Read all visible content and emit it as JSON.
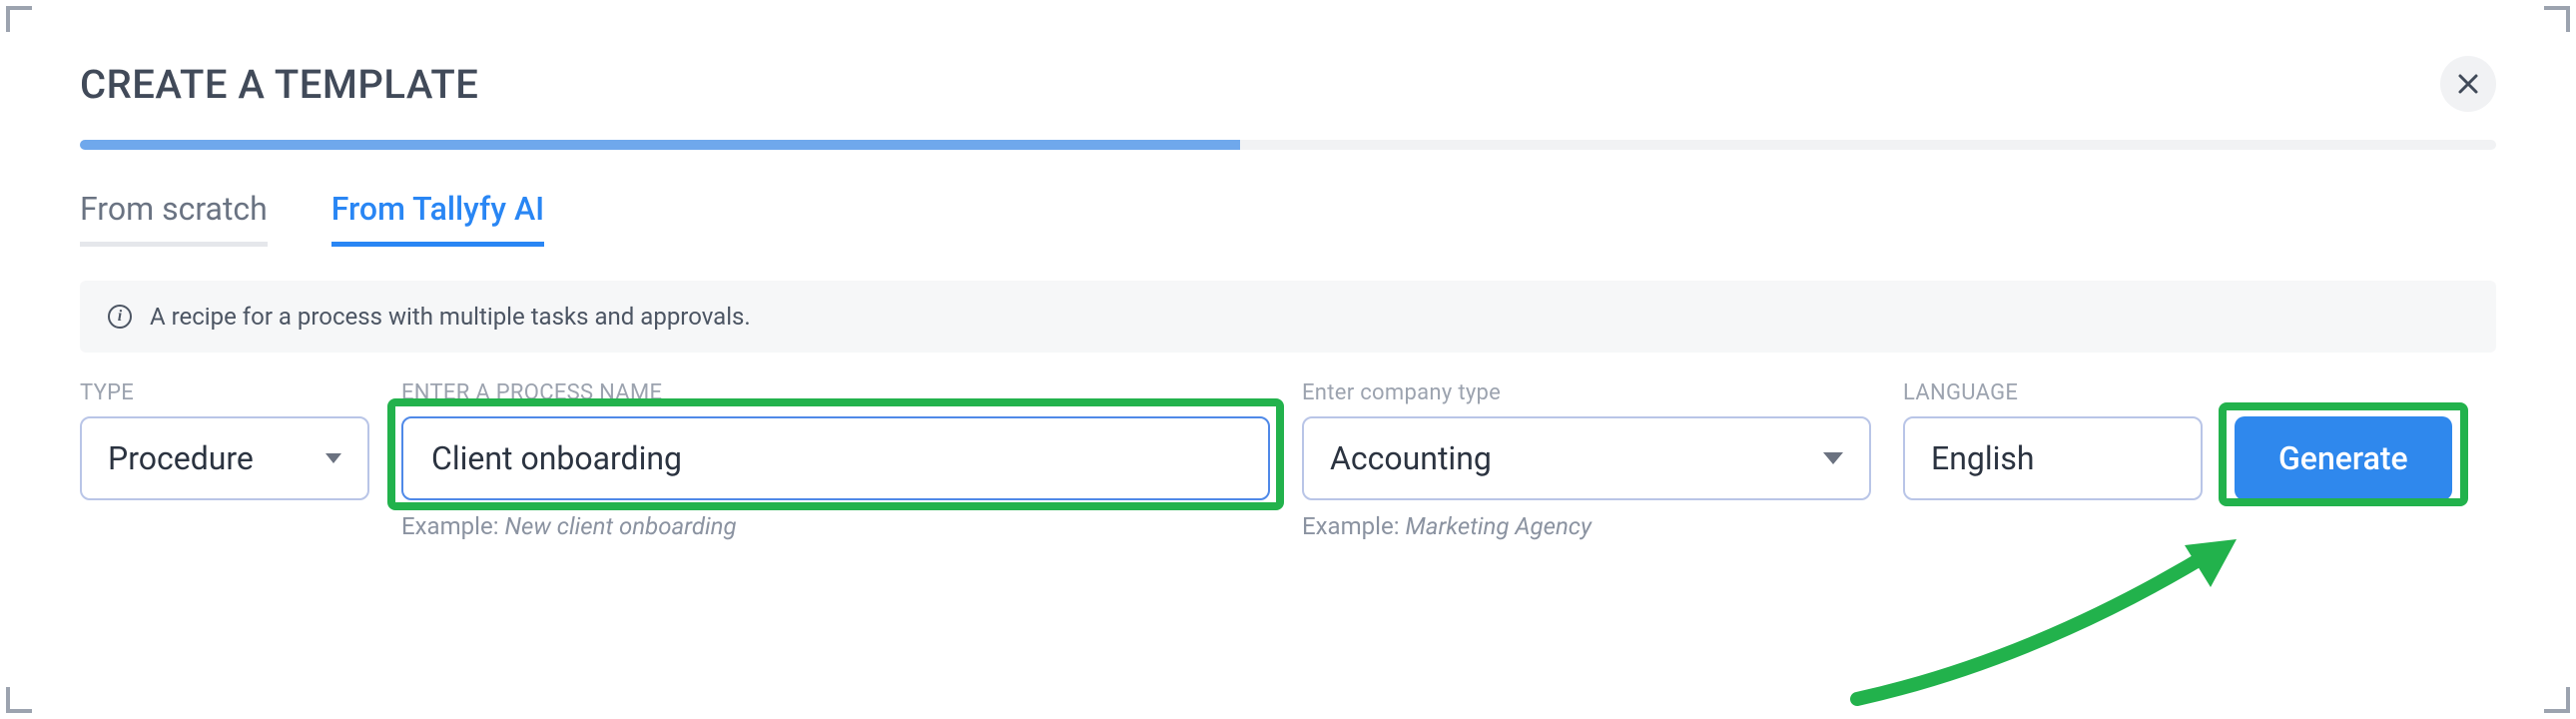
{
  "header": {
    "title": "CREATE A TEMPLATE",
    "close_aria": "Close"
  },
  "progress": {
    "percent": 48
  },
  "tabs": {
    "items": [
      {
        "label": "From scratch",
        "active": false
      },
      {
        "label": "From Tallyfy AI",
        "active": true
      }
    ]
  },
  "info": {
    "text": "A recipe for a process with multiple tasks and approvals."
  },
  "form": {
    "type": {
      "label": "TYPE",
      "value": "Procedure"
    },
    "process_name": {
      "label": "ENTER A PROCESS NAME",
      "value": "Client onboarding",
      "example_prefix": "Example: ",
      "example_value": "New client onboarding"
    },
    "company_type": {
      "label": "Enter company type",
      "value": "Accounting",
      "example_prefix": "Example: ",
      "example_value": "Marketing Agency"
    },
    "language": {
      "label": "LANGUAGE",
      "value": "English"
    },
    "generate_label": "Generate"
  },
  "annotation": {
    "arrow_color": "#22b24c",
    "highlight_color": "#22b24c"
  }
}
